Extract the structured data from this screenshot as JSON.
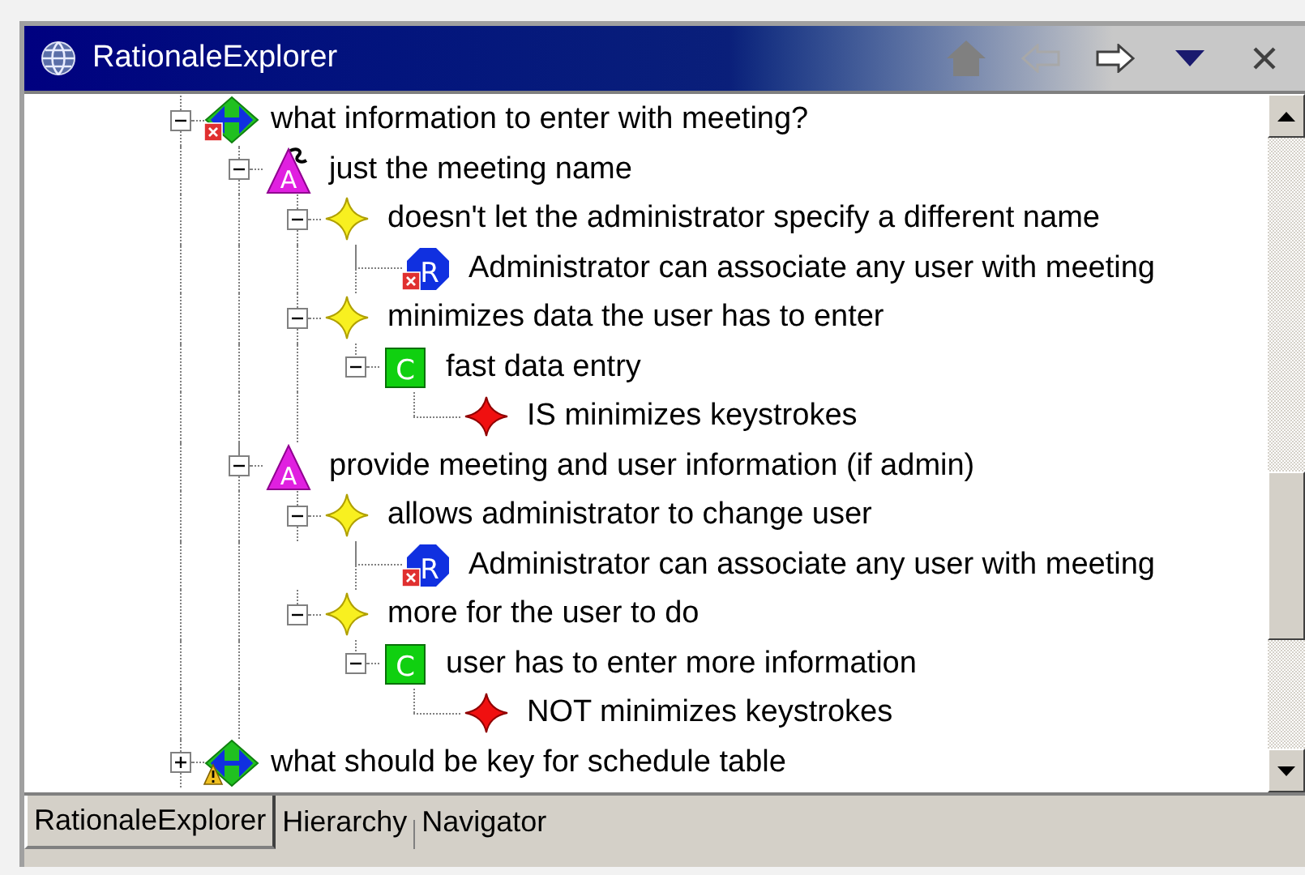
{
  "window": {
    "title": "RationaleExplorer"
  },
  "toolbar": [
    {
      "kind": "home",
      "disabled": true
    },
    {
      "kind": "back",
      "disabled": true
    },
    {
      "kind": "forward",
      "disabled": false
    },
    {
      "kind": "menu",
      "disabled": false
    },
    {
      "kind": "close",
      "disabled": false
    }
  ],
  "tree": [
    {
      "kind": "question",
      "error": true,
      "warning": false,
      "flagged": false,
      "label": "what information to enter with meeting?",
      "expanded": true,
      "children": [
        {
          "kind": "alternative",
          "icon_letter": "A",
          "error": false,
          "warning": false,
          "flagged": true,
          "label": "just the meeting name",
          "expanded": true,
          "children": [
            {
              "kind": "argument",
              "error": false,
              "warning": false,
              "flagged": false,
              "label": "doesn't let the administrator specify a different name",
              "expanded": true,
              "children": [
                {
                  "kind": "requirement",
                  "icon_letter": "R",
                  "error": true,
                  "warning": false,
                  "flagged": false,
                  "label": "Administrator can associate any user with meeting"
                }
              ]
            },
            {
              "kind": "argument",
              "error": false,
              "warning": false,
              "flagged": false,
              "label": "minimizes data the user has to enter",
              "expanded": true,
              "children": [
                {
                  "kind": "claim",
                  "icon_letter": "C",
                  "error": false,
                  "warning": false,
                  "flagged": false,
                  "label": "fast data entry",
                  "expanded": true,
                  "children": [
                    {
                      "kind": "assumption",
                      "error": false,
                      "warning": false,
                      "flagged": false,
                      "label": "IS minimizes keystrokes"
                    }
                  ]
                }
              ]
            }
          ]
        },
        {
          "kind": "alternative",
          "icon_letter": "A",
          "error": false,
          "warning": false,
          "flagged": false,
          "label": "provide meeting and user information (if admin)",
          "expanded": true,
          "children": [
            {
              "kind": "argument",
              "error": false,
              "warning": false,
              "flagged": false,
              "label": "allows administrator to change user",
              "expanded": true,
              "children": [
                {
                  "kind": "requirement",
                  "icon_letter": "R",
                  "error": true,
                  "warning": false,
                  "flagged": false,
                  "label": "Administrator can associate any user with meeting"
                }
              ]
            },
            {
              "kind": "argument",
              "error": false,
              "warning": false,
              "flagged": false,
              "label": "more for the user to do",
              "expanded": true,
              "children": [
                {
                  "kind": "claim",
                  "icon_letter": "C",
                  "error": false,
                  "warning": false,
                  "flagged": false,
                  "label": "user has to enter more information",
                  "expanded": true,
                  "children": [
                    {
                      "kind": "assumption",
                      "error": false,
                      "warning": false,
                      "flagged": false,
                      "label": "NOT minimizes keystrokes"
                    }
                  ]
                }
              ]
            }
          ]
        }
      ]
    },
    {
      "kind": "question",
      "error": false,
      "warning": true,
      "flagged": false,
      "label": "what should be key for schedule table",
      "expanded": false
    }
  ],
  "tabs": [
    {
      "label": "RationaleExplorer",
      "selected": true
    },
    {
      "label": "Hierarchy",
      "selected": false
    },
    {
      "label": "Navigator",
      "selected": false
    }
  ]
}
